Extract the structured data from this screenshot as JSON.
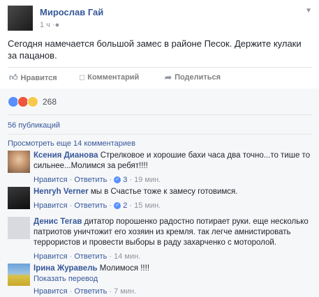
{
  "post": {
    "author": "Мирослав Гай",
    "time": "1 ч",
    "text": "Сегодня намечается большой замес в районе Песок. Держите кулаки за пацанов.",
    "actions": {
      "like": "Нравится",
      "comment": "Комментарий",
      "share": "Поделиться"
    },
    "reactions_count": "268",
    "shares": "56 публикаций",
    "more_comments": "Просмотреть еще 14 комментариев"
  },
  "comments": [
    {
      "author": "Ксения Дианова",
      "text": "Стрелковое и хорошие бахи часа два точно...то тише то сильнее...Молимся за ребят!!!!",
      "like": "Нравится",
      "reply": "Ответить",
      "likes": "3",
      "time": "19 мин."
    },
    {
      "author": "Henryh Verner",
      "text": "мы в Счастье тоже к замесу готовимся.",
      "like": "Нравится",
      "reply": "Ответить",
      "likes": "2",
      "time": "15 мин."
    },
    {
      "author": "Денис Тегав",
      "text": "дитатор порошенко радостно потирает руки. еще несколько патриотов уничтожит его хозяин из кремля. так легче амнистировать террористов и провести выборы в раду захарченко с моторолой.",
      "like": "Нравится",
      "reply": "Ответить",
      "time": "14 мин."
    },
    {
      "author": "Ірина Журавель",
      "text": "Молимося !!!!",
      "translate": "Показать перевод",
      "like": "Нравится",
      "reply": "Ответить",
      "time": "7 мин."
    }
  ],
  "colors": {
    "link": "#365899",
    "grey": "#90949c",
    "like_blue": "#5890ff"
  }
}
